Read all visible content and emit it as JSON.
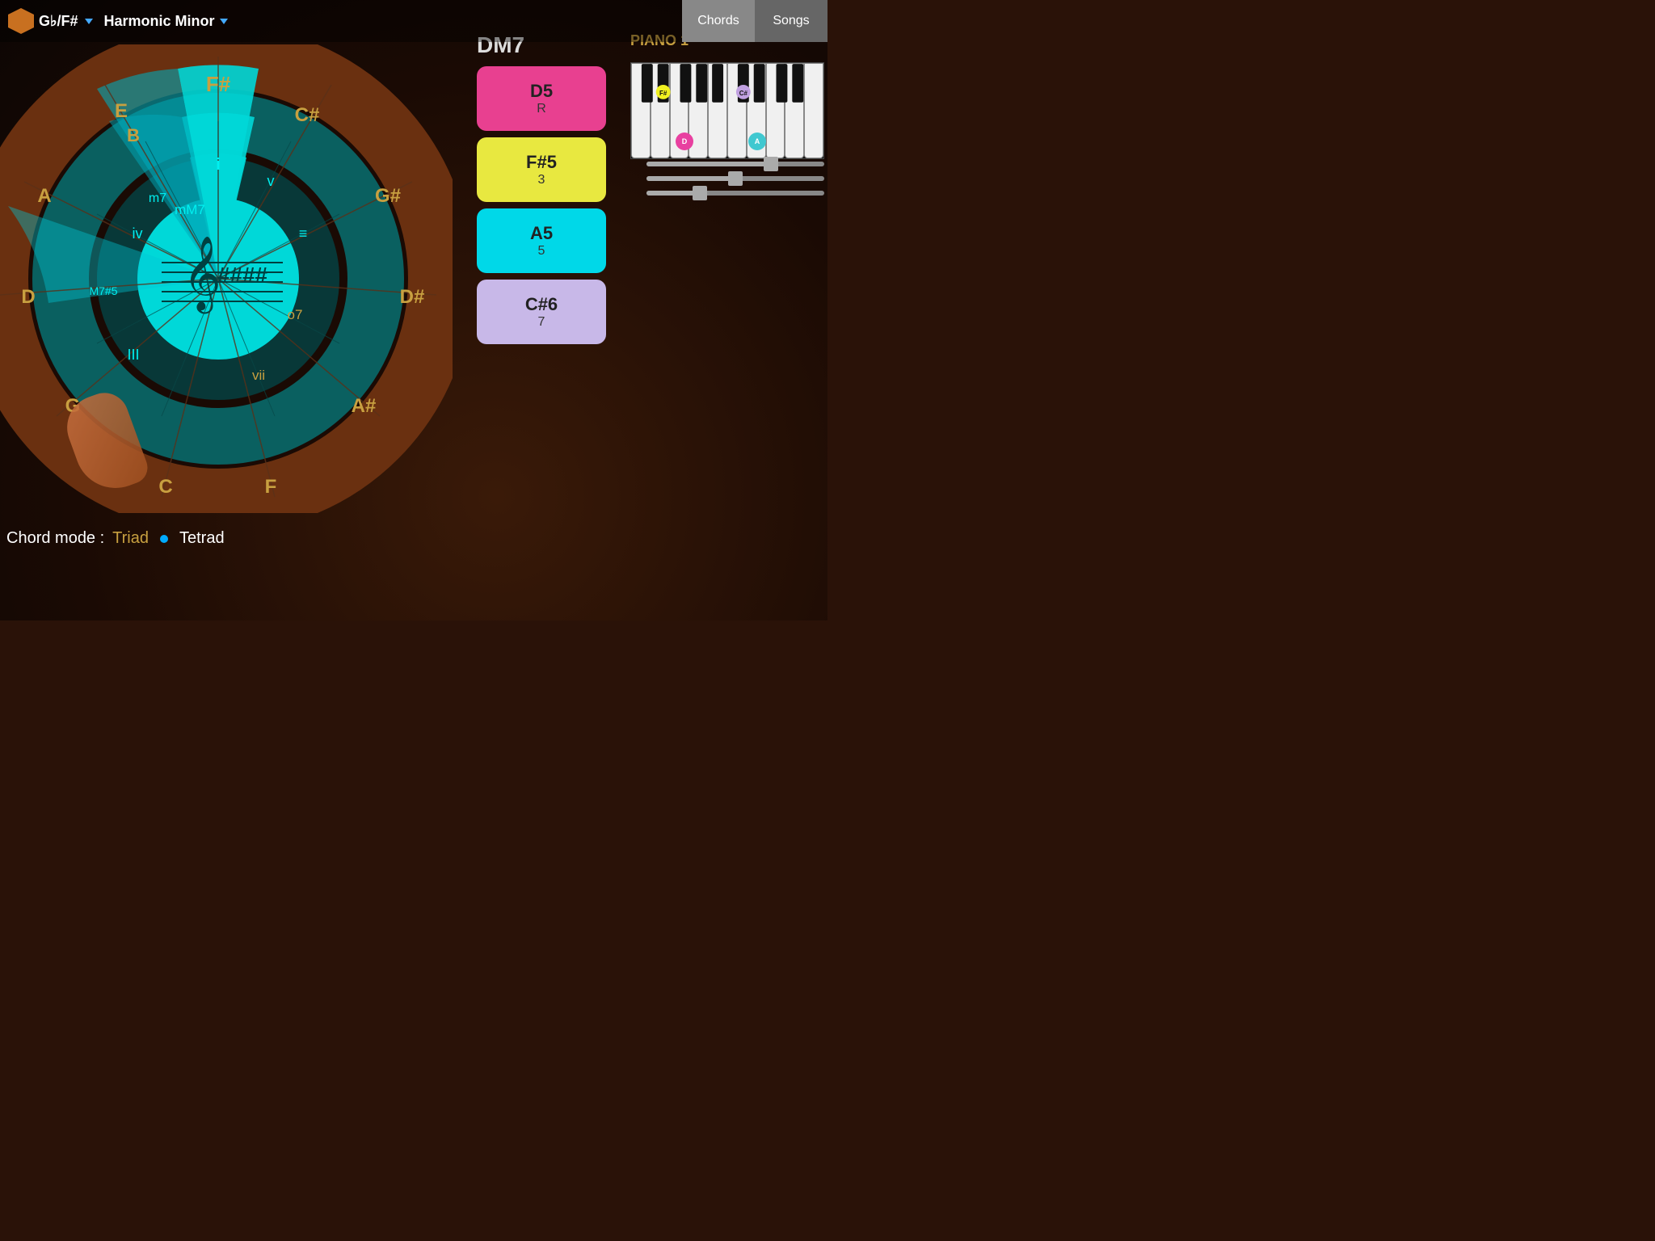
{
  "topbar": {
    "key": "G♭/F#",
    "scale": "Harmonic Minor",
    "buttons": [
      {
        "label": "Chords",
        "active": true
      },
      {
        "label": "Songs",
        "active": false
      }
    ]
  },
  "chord": {
    "name": "DM7",
    "notes": [
      {
        "name": "D5",
        "role": "R",
        "color": "pink"
      },
      {
        "name": "F#5",
        "role": "3",
        "color": "yellow"
      },
      {
        "name": "A5",
        "role": "5",
        "color": "cyan"
      },
      {
        "name": "C#6",
        "role": "7",
        "color": "lavender"
      }
    ]
  },
  "piano": {
    "label": "PIANO  1",
    "highlighted_notes": [
      {
        "note": "F#",
        "color": "#f0f020"
      },
      {
        "note": "C#",
        "color": "#c0a0e0"
      },
      {
        "note": "D",
        "color": "#e040a0"
      },
      {
        "note": "A",
        "color": "#40c8d0"
      }
    ]
  },
  "circle": {
    "center_symbol": "𝄞",
    "sharps": "####",
    "notes_outer": [
      "C#",
      "G#",
      "D#/A#",
      "F",
      "C",
      "G",
      "D",
      "A",
      "E",
      "B",
      "F#"
    ],
    "notes_inner_roman": [
      "i",
      "v",
      "≡",
      "o7",
      "vii",
      "lll",
      "iv",
      "mM7",
      "m7"
    ],
    "selected_note": "F#"
  },
  "chord_mode": {
    "label": "Chord mode :",
    "options": [
      {
        "label": "Triad",
        "active": false
      },
      {
        "label": "Tetrad",
        "active": true
      }
    ]
  },
  "sliders": [
    {
      "value": 70
    },
    {
      "value": 50
    },
    {
      "value": 30
    }
  ]
}
